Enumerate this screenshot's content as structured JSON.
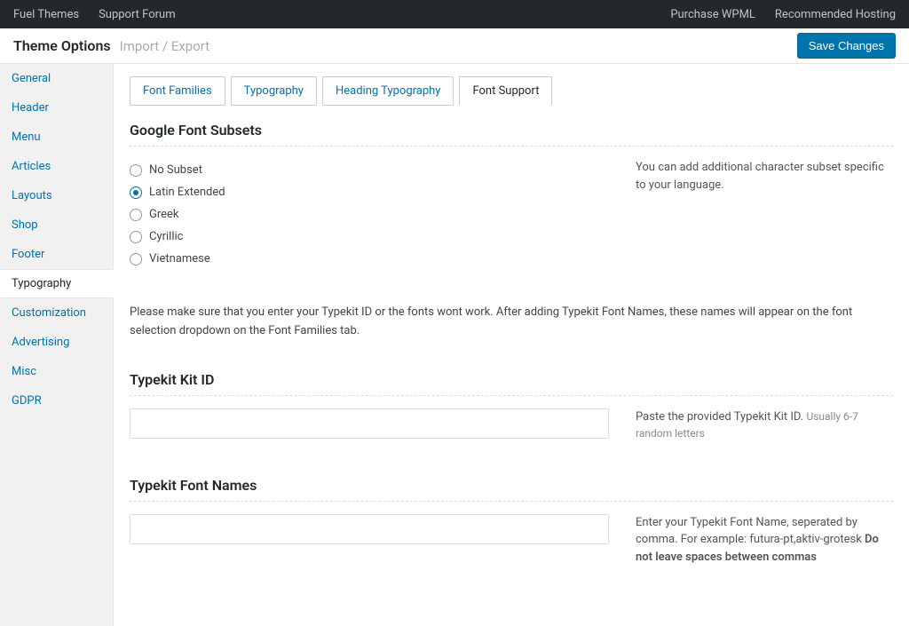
{
  "topbar": {
    "left": [
      "Fuel Themes",
      "Support Forum"
    ],
    "right": [
      "Purchase WPML",
      "Recommended Hosting"
    ]
  },
  "header": {
    "title": "Theme Options",
    "subtitle": "Import / Export",
    "save": "Save Changes"
  },
  "sidebar": {
    "items": [
      "General",
      "Header",
      "Menu",
      "Articles",
      "Layouts",
      "Shop",
      "Footer",
      "Typography",
      "Customization",
      "Advertising",
      "Misc",
      "GDPR"
    ],
    "active": "Typography"
  },
  "tabs": {
    "items": [
      "Font Families",
      "Typography",
      "Heading Typography",
      "Font Support"
    ],
    "active": "Font Support"
  },
  "section1": {
    "title": "Google Font Subsets",
    "options": [
      "No Subset",
      "Latin Extended",
      "Greek",
      "Cyrillic",
      "Vietnamese"
    ],
    "selected": "Latin Extended",
    "help": "You can add additional character subset specific to your language."
  },
  "note": "Please make sure that you enter your Typekit ID or the fonts wont work. After adding Typekit Font Names, these names will appear on the font selection dropdown on the Font Families tab.",
  "section2": {
    "title": "Typekit Kit ID",
    "help1": "Paste the provided Typekit Kit ID. ",
    "help2": "Usually 6-7 random letters"
  },
  "section3": {
    "title": "Typekit Font Names",
    "help1": "Enter your Typekit Font Name, seperated by comma. For example: futura-pt,aktiv-grotesk ",
    "help2": "Do not leave spaces between commas"
  }
}
